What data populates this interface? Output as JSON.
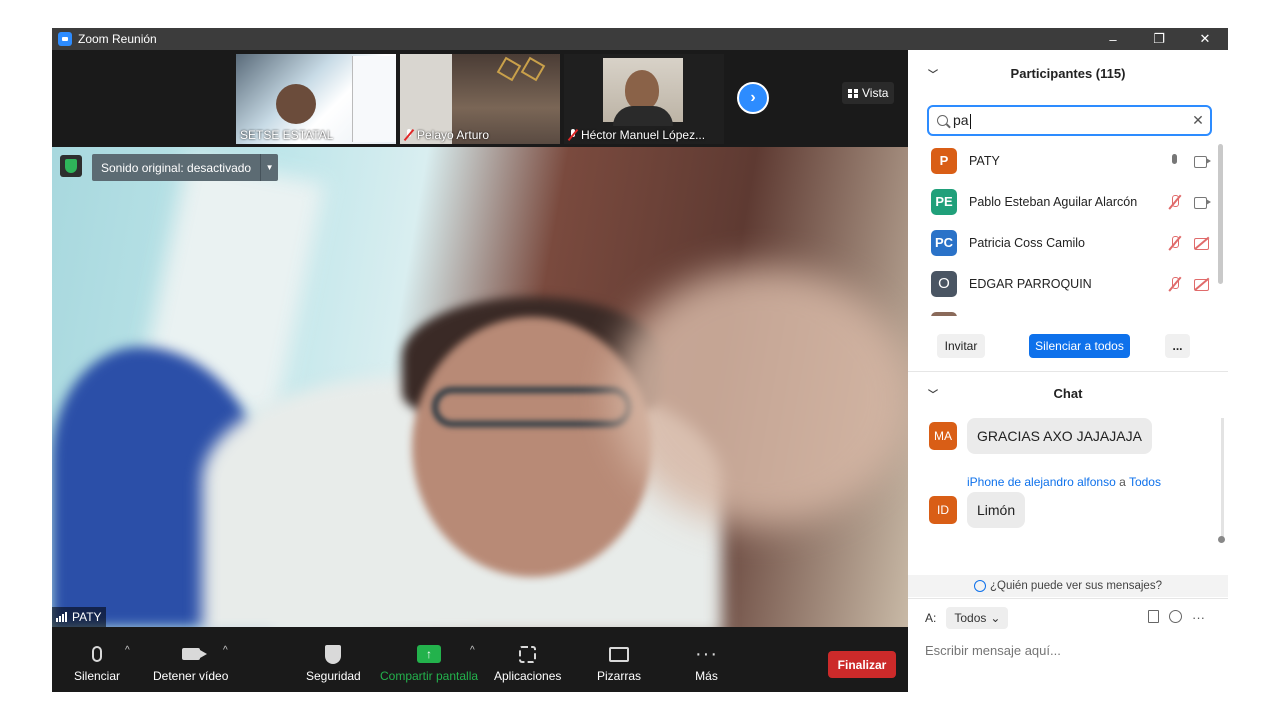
{
  "window": {
    "title": "Zoom Reunión",
    "controls": [
      "–",
      "❐",
      "✕"
    ]
  },
  "thumbnails": [
    {
      "name": "SETSE ESTATAL",
      "muted": false
    },
    {
      "name": "Pelayo Arturo",
      "muted": true
    },
    {
      "name": "Héctor Manuel López...",
      "muted": true
    }
  ],
  "view_button": {
    "label": "Vista"
  },
  "original_sound": {
    "label": "Sonido original: desactivado"
  },
  "main_speaker": {
    "name": "PATY"
  },
  "toolbar": {
    "mute": "Silenciar",
    "stop_video": "Detener vídeo",
    "security": "Seguridad",
    "share_screen": "Compartir pantalla",
    "apps": "Aplicaciones",
    "whiteboards": "Pizarras",
    "more": "Más",
    "end": "Finalizar"
  },
  "participants": {
    "header": "Participantes (115)",
    "search_value": "pa",
    "list": [
      {
        "initials": "P",
        "name": "PATY",
        "color": "#d95e16",
        "mic": "on",
        "cam": "on"
      },
      {
        "initials": "PE",
        "name": "Pablo Esteban Aguilar Alarcón",
        "color": "#20a07a",
        "mic": "off",
        "cam": "on"
      },
      {
        "initials": "PC",
        "name": "Patricia Coss Camilo",
        "color": "#2a72c8",
        "mic": "off",
        "cam": "off"
      },
      {
        "initials": "O",
        "name": "EDGAR PARROQUIN",
        "color": "#4a5563",
        "mic": "off",
        "cam": "off"
      }
    ],
    "invite": "Invitar",
    "mute_all": "Silenciar a todos",
    "more": "..."
  },
  "chat": {
    "header": "Chat",
    "messages": [
      {
        "initials": "MA",
        "sender": "",
        "text": "GRACIAS  AXO JAJAJAJA"
      },
      {
        "initials": "ID",
        "sender": "iPhone de alejandro alfonso",
        "to_word": "a",
        "to": "Todos",
        "text": "Limón"
      }
    ],
    "privacy": "¿Quién puede ver sus mensajes?",
    "to_label": "A:",
    "to_value": "Todos",
    "input_placeholder": "Escribir mensaje aquí..."
  }
}
